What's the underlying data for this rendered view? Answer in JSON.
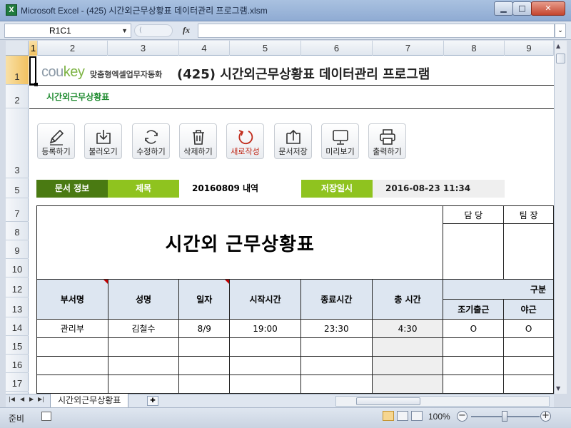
{
  "window": {
    "title": "Microsoft Excel - (425) 시간외근무상황표 데이터관리 프로그램.xlsm"
  },
  "formula_bar": {
    "name_box": "R1C1",
    "fx": "fx",
    "formula": ""
  },
  "columns": [
    "1",
    "2",
    "3",
    "4",
    "5",
    "6",
    "7",
    "8",
    "9"
  ],
  "rows": [
    "1",
    "2",
    "3",
    "5",
    "7",
    "8",
    "9",
    "10",
    "12",
    "13",
    "14",
    "15",
    "16",
    "17"
  ],
  "header": {
    "logo": "coukey",
    "logo_tagline": "맞춤형엑셀업무자동화",
    "title": "(425) 시간외근무상황표 데이터관리 프로그램",
    "subtitle": "시간외근무상황표"
  },
  "toolbar": [
    {
      "label": "등록하기",
      "icon": "pencil-icon"
    },
    {
      "label": "불러오기",
      "icon": "load-icon"
    },
    {
      "label": "수정하기",
      "icon": "refresh-icon"
    },
    {
      "label": "삭제하기",
      "icon": "trash-icon"
    },
    {
      "label": "새로작성",
      "icon": "new-icon"
    },
    {
      "label": "문서저장",
      "icon": "save-icon"
    },
    {
      "label": "미리보기",
      "icon": "preview-icon"
    },
    {
      "label": "출력하기",
      "icon": "print-icon"
    }
  ],
  "doc_info": {
    "section_label": "문서 정보",
    "title_label": "제목",
    "title_value": "20160809 내역",
    "saved_label": "저장일시",
    "saved_value": "2016-08-23 11:34"
  },
  "report": {
    "big_title": "시간외 근무상황표",
    "approval": [
      "담 당",
      "팀 장"
    ],
    "headers": [
      "부서명",
      "성명",
      "일자",
      "시작시간",
      "종료시간",
      "총 시간",
      "구분"
    ],
    "sub_headers": [
      "조기출근",
      "야근"
    ],
    "rows": [
      {
        "dept": "관리부",
        "name": "김철수",
        "date": "8/9",
        "start": "19:00",
        "end": "23:30",
        "total": "4:30",
        "early": "O",
        "night": "O"
      },
      {
        "dept": "",
        "name": "",
        "date": "",
        "start": "",
        "end": "",
        "total": "",
        "early": "",
        "night": ""
      },
      {
        "dept": "",
        "name": "",
        "date": "",
        "start": "",
        "end": "",
        "total": "",
        "early": "",
        "night": ""
      },
      {
        "dept": "",
        "name": "",
        "date": "",
        "start": "",
        "end": "",
        "total": "",
        "early": "",
        "night": ""
      }
    ]
  },
  "sheet_tab": "시간외근무상황표",
  "status": {
    "text": "준비",
    "zoom": "100%"
  },
  "colors": {
    "accent_dark": "#4a7a12",
    "accent_light": "#8fc31f",
    "header_fill": "#dde6f1"
  }
}
